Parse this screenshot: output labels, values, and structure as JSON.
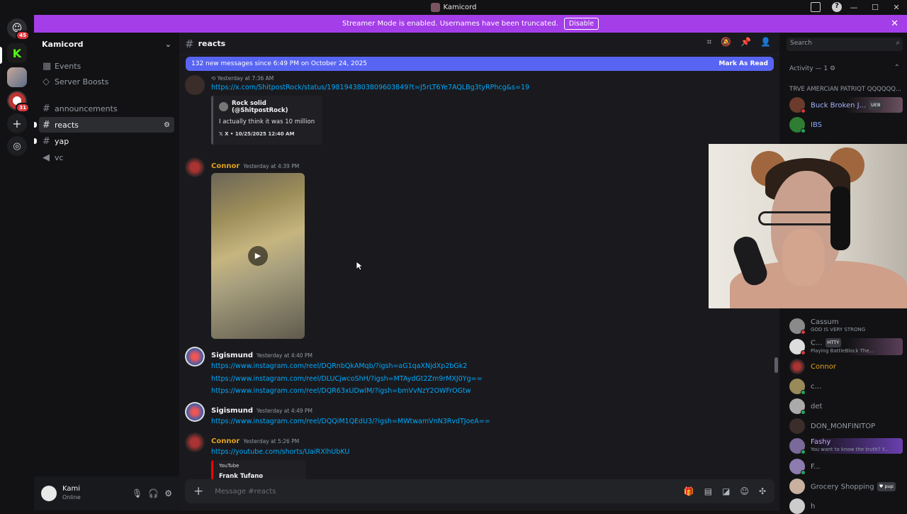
{
  "window": {
    "title": "Kamicord",
    "controls": [
      "—",
      "☐",
      "✕"
    ]
  },
  "banner": {
    "text": "Streamer Mode is enabled. Usernames have been truncated.",
    "button": "Disable"
  },
  "servers": [
    {
      "name": "discord-home",
      "badge": "45"
    },
    {
      "name": "server-kick",
      "badge": ""
    },
    {
      "name": "server-kamicord",
      "badge": ""
    },
    {
      "name": "server-three",
      "badge": "31"
    }
  ],
  "guild": {
    "name": "Kamicord",
    "events": "Events",
    "boosts": "Server Boosts",
    "channels": [
      {
        "name": "announcements",
        "type": "text"
      },
      {
        "name": "reacts",
        "type": "text"
      },
      {
        "name": "yap",
        "type": "text"
      },
      {
        "name": "vc",
        "type": "voice"
      }
    ]
  },
  "user": {
    "name": "Kami",
    "status": "Online"
  },
  "channel": {
    "name": "reacts",
    "new_messages": "132 new messages since 6:49 PM on October 24, 2025",
    "mark_read": "Mark As Read",
    "composer_placeholder": "Message #reacts"
  },
  "search": {
    "placeholder": "Search"
  },
  "messages": [
    {
      "author": "",
      "time": "Yesterday at 7:36 AM",
      "link": "https://x.com/ShitpostRock/status/1981943803809603849?t=J5rLT6Ye7AQLBg3tyRPhcg&s=19",
      "embed": {
        "author": "Rock solid (@ShitpostRock)",
        "text": "I actually think it was 10 million",
        "footer": "X • 10/25/2025 12:40 AM"
      }
    },
    {
      "author": "Connor",
      "time": "Yesterday at 4:39 PM",
      "media": "video"
    },
    {
      "author": "Sigismund",
      "time": "Yesterday at 4:40 PM",
      "links": [
        "https://www.instagram.com/reel/DQRnbQkAMqb/?igsh=aG1qaXNjdXp2bGk2",
        "https://www.instagram.com/reel/DLUCjwcoShH/?igsh=MTAydGt2Zm9rMXJ0Yg==",
        "https://www.instagram.com/reel/DQR63xUDwlM/?igsh=bmVvNzY2OWFrOGtw"
      ]
    },
    {
      "author": "Sigismund",
      "time": "Yesterday at 4:49 PM",
      "link": "https://www.instagram.com/reel/DQQiM1QEdU3/?igsh=MWtwamVnN3RvdTJoeA=="
    },
    {
      "author": "Connor",
      "time": "Yesterday at 5:26 PM",
      "link": "https://youtube.com/shorts/UaiRXlhUbKU",
      "embed": {
        "provider": "YouTube",
        "title": "Frank Tufano"
      }
    }
  ],
  "members": {
    "activity_header": "Activity — 1",
    "activity_text": "TRVE AMERCIAN PATRIQT QQQQQQ...",
    "list": [
      {
        "name": "Buck Broken J...",
        "tag": "UEB",
        "sub": ""
      },
      {
        "name": "IBS",
        "tag": "",
        "sub": ""
      },
      {
        "name": "Cassum",
        "tag": "",
        "sub": "GOD IS VERY STRONG"
      },
      {
        "name": "C...",
        "tag": "HTTY",
        "sub": "Playing BattleBlock The..."
      },
      {
        "name": "Connor",
        "tag": "",
        "sub": ""
      },
      {
        "name": "c...",
        "tag": "",
        "sub": ""
      },
      {
        "name": "det",
        "tag": "",
        "sub": ""
      },
      {
        "name": "DON_MONFINITOP",
        "tag": "",
        "sub": ""
      },
      {
        "name": "Fashy",
        "tag": "",
        "sub": "You want to know the truth? Y..."
      },
      {
        "name": "F...",
        "tag": "",
        "sub": ""
      },
      {
        "name": "Grocery Shopping",
        "tag": "pup",
        "sub": ""
      },
      {
        "name": "h",
        "tag": "",
        "sub": ""
      }
    ]
  },
  "colors": {
    "accent": "#5865f2",
    "banner": "#a43ee8",
    "link": "#00a8fc",
    "connor": "#e0a21c",
    "sigismund": "#f2f3f5",
    "buck": "#a6b4ff",
    "ibs": "#8ea7ff"
  }
}
